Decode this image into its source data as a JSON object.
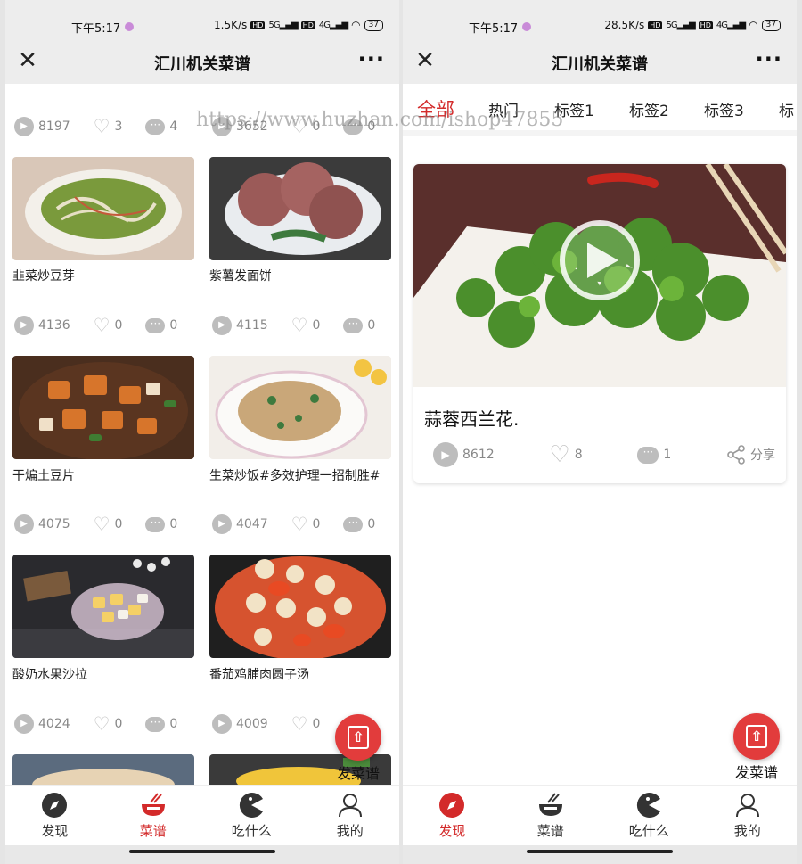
{
  "status": {
    "time": "下午5:17",
    "left_speed": "1.5K/s",
    "right_speed": "28.5K/s",
    "battery": "37",
    "net_a": "5G",
    "net_b": "4G",
    "hd": "HD"
  },
  "app": {
    "title": "汇川机关菜谱",
    "close_glyph": "✕",
    "more_glyph": "···"
  },
  "watermark": "https://www.huzhan.com/ishop47855",
  "left": {
    "top_stats": [
      {
        "plays": "8197",
        "likes": "3",
        "comments": "4"
      },
      {
        "plays": "3652",
        "likes": "0",
        "comments": "0"
      }
    ],
    "recipes": [
      {
        "title": "韭菜炒豆芽",
        "plays": "4136",
        "likes": "0",
        "comments": "0",
        "color": "#7a9a3c"
      },
      {
        "title": "紫薯发面饼",
        "plays": "4115",
        "likes": "0",
        "comments": "0",
        "color": "#9b5a58"
      },
      {
        "title": "干煸土豆片",
        "plays": "4075",
        "likes": "0",
        "comments": "0",
        "color": "#d7752b"
      },
      {
        "title": "生菜炒饭#多效护理一招制胜#",
        "plays": "4047",
        "likes": "0",
        "comments": "0",
        "color": "#c9a779"
      },
      {
        "title": "酸奶水果沙拉",
        "plays": "4024",
        "likes": "0",
        "comments": "0",
        "color": "#b98e55"
      },
      {
        "title": "番茄鸡脯肉圆子汤",
        "plays": "4009",
        "likes": "0",
        "comments": "0",
        "color": "#d6532f"
      }
    ]
  },
  "right": {
    "categories": [
      "全部",
      "热门",
      "标签1",
      "标签2",
      "标签3",
      "标"
    ],
    "video": {
      "title": "蒜蓉西兰花.",
      "plays": "8612",
      "likes": "8",
      "comments": "1",
      "share": "分享"
    }
  },
  "fab": {
    "label": "发菜谱",
    "color": "#e23c3c"
  },
  "tabbar": [
    "发现",
    "菜谱",
    "吃什么",
    "我的"
  ],
  "colors": {
    "accent": "#d32a2a",
    "icon_gray": "#bdbdbd"
  },
  "icons": {
    "play": "▶",
    "heart": "♡",
    "comment": "···",
    "share": "share-icon",
    "upload": "⇧"
  }
}
